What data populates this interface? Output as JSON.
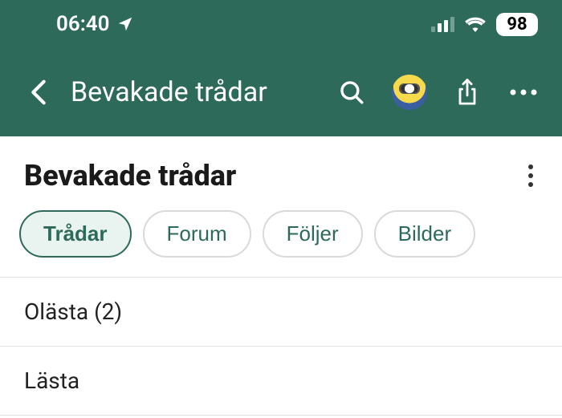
{
  "status": {
    "time": "06:40",
    "battery": "98"
  },
  "nav": {
    "title": "Bevakade trådar"
  },
  "page": {
    "heading": "Bevakade trådar"
  },
  "tabs": {
    "items": [
      {
        "label": "Trådar"
      },
      {
        "label": "Forum"
      },
      {
        "label": "Följer"
      },
      {
        "label": "Bilder"
      }
    ],
    "active_index": 0
  },
  "sections": [
    {
      "label": "Olästa (2)"
    },
    {
      "label": "Lästa"
    }
  ]
}
